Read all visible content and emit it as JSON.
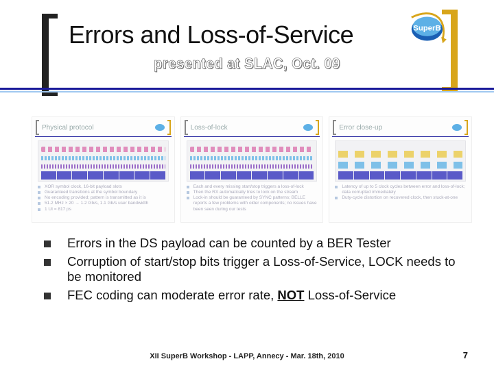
{
  "title": "Errors and Loss-of-Service",
  "subtitle": "presented at SLAC, Oct. 09",
  "logo_text": "SuperB",
  "thumbnails": [
    {
      "heading": "Physical protocol",
      "notes": [
        "XOR symbol clock, 16-bit payload slots",
        "Guaranteed transitions at the symbol boundary",
        "No encoding provided; pattern is transmitted as it is",
        "51.2 MHz × 20 → 1.2 Gb/s, 1.1 Gb/s user bandwidth",
        "1 UI = 817 ps"
      ]
    },
    {
      "heading": "Loss-of-lock",
      "notes": [
        "Each and every missing start/stop triggers a loss-of-lock",
        "Then the RX automatically tries to lock on the stream",
        "Lock-in should be guaranteed by SYNC patterns; BELLE reports a few problems with older components; no issues have been seen during our tests"
      ]
    },
    {
      "heading": "Error close-up",
      "notes": [
        "Latency of up to 5 clock cycles between error and loss-of-lock; data corrupted immediately",
        "Duty-cycle distortion on recovered clock, then stuck-at-one"
      ]
    }
  ],
  "main_bullets": [
    {
      "pre": "Errors in the DS payload can be counted by a BER Tester"
    },
    {
      "pre": "Corruption of start/stop bits trigger a Loss-of-Service, LOCK needs to be monitored"
    },
    {
      "pre": "FEC coding can moderate error rate, ",
      "emph": "NOT",
      "post": " Loss-of-Service"
    }
  ],
  "footer": {
    "center": "XII SuperB Workshop - LAPP, Annecy - Mar. 18th, 2010",
    "page": "7"
  }
}
